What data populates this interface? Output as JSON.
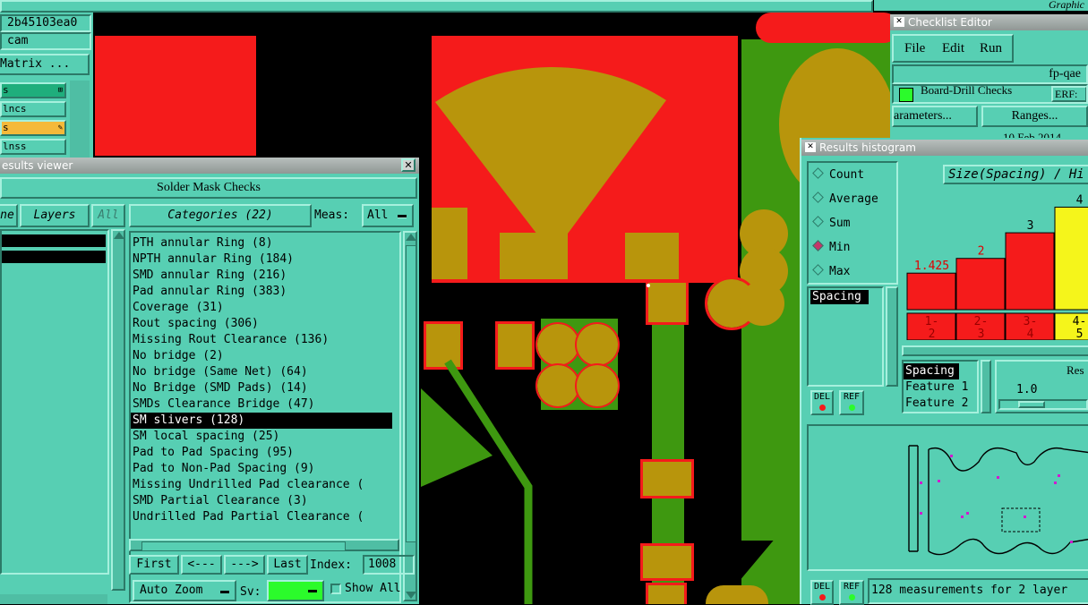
{
  "top_left": {
    "id_value": "2b45103ea0",
    "job_value": "cam",
    "matrix_button": "Matrix ...",
    "layers": [
      {
        "label": "s",
        "color": "#1fae7c"
      },
      {
        "label": "lncs",
        "color": "#57cfb3"
      },
      {
        "label": "s",
        "color": "#f5b93a"
      },
      {
        "label": "lnss",
        "color": "#57cfb3"
      }
    ]
  },
  "top_right_label": "Graphic",
  "results_viewer": {
    "title": "esults viewer",
    "header": "Solder Mask Checks",
    "left_tabs": [
      "ne",
      "Layers",
      "All"
    ],
    "categories_button": "Categories (22)",
    "meas_label": "Meas:",
    "meas_value": "All",
    "categories": [
      "PTH annular Ring (8)",
      "NPTH annular Ring (184)",
      "SMD annular Ring (216)",
      "Pad annular Ring (383)",
      "Coverage (31)",
      "Rout spacing (306)",
      "Missing Rout Clearance (136)",
      "No bridge (2)",
      "No bridge (Same Net) (64)",
      "No Bridge (SMD Pads) (14)",
      "SMDs Clearance Bridge (47)",
      "SM slivers (128)",
      "SM local spacing (25)",
      "Pad to Pad Spacing (95)",
      "Pad to Non-Pad Spacing (9)",
      "Missing Undrilled Pad clearance (",
      "SMD Partial Clearance (3)",
      "Undrilled Pad Partial Clearance ("
    ],
    "selected_index": 11,
    "nav": {
      "first": "First",
      "prev": "<---",
      "next": "--->",
      "last": "Last",
      "index_label": "Index:",
      "index_value": "1008"
    },
    "auto_zoom": "Auto Zoom",
    "sv_label": "Sv:",
    "sv_color": "#2bfb2b",
    "show_all": "Show All"
  },
  "checklist_editor": {
    "title": "Checklist Editor",
    "menu": [
      "File",
      "Edit",
      "Run"
    ],
    "name": "fp-qae",
    "check_item": "Board-Drill Checks",
    "erf": "ERF:",
    "parameters_button": "arameters...",
    "ranges_button": "Ranges...",
    "date": "10 Feb 2014"
  },
  "histogram": {
    "title": "Results histogram",
    "options": [
      {
        "label": "Count",
        "selected": false
      },
      {
        "label": "Average",
        "selected": false
      },
      {
        "label": "Sum",
        "selected": false
      },
      {
        "label": "Min",
        "selected": true
      },
      {
        "label": "Max",
        "selected": false
      }
    ],
    "list_item": "Spacing",
    "del_label": "DEL",
    "ref_label": "REF",
    "chart_title": "Size(Spacing) / Hi",
    "fields": [
      "Spacing",
      "Feature 1",
      "Feature 2"
    ],
    "res_label": "Res",
    "slider_value": "1.0",
    "status_text": "128 measurements for 2 layer",
    "chart_data": {
      "type": "bar",
      "categories": [
        "1-2",
        "2-3",
        "3-4",
        "4-5"
      ],
      "category_lines": [
        [
          "1-",
          "2"
        ],
        [
          "2-",
          "3"
        ],
        [
          "3-",
          "4"
        ],
        [
          "4-",
          "5"
        ]
      ],
      "values": [
        1.425,
        2,
        3,
        4
      ],
      "labels": [
        "1.425",
        "2",
        "3",
        "4"
      ],
      "colors": [
        "#f51b1b",
        "#f51b1b",
        "#f51b1b",
        "#f5f51b"
      ],
      "label_colors": [
        "#e00000",
        "#e00000",
        "#000000",
        "#000000"
      ],
      "ylim": [
        0,
        4.4
      ]
    }
  }
}
